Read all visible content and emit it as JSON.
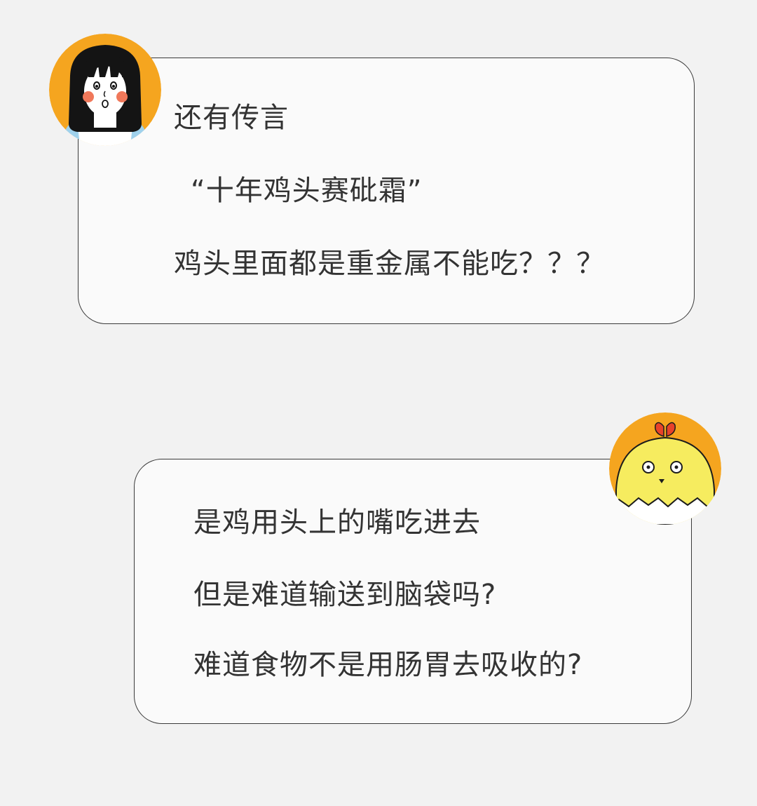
{
  "conversation": {
    "message_1": {
      "speaker": "girl-avatar",
      "lines": [
        "还有传言",
        "“十年鸡头赛砒霜”",
        "鸡头里面都是重金属不能吃？？？"
      ]
    },
    "message_2": {
      "speaker": "chick-avatar",
      "lines": [
        "是鸡用头上的嘴吃进去",
        "但是难道输送到脑袋吗?",
        "难道食物不是用肠胃去吸收的?"
      ]
    }
  },
  "colors": {
    "background": "#f2f2f2",
    "bubble_fill": "#fafafa",
    "bubble_border": "#3a3a3a",
    "text": "#333333",
    "avatar_orange": "#f5a51f",
    "chick_yellow": "#f6ec5f",
    "comb_red": "#e8422a",
    "cheek_pink": "#f0785a"
  },
  "icons": [
    "girl-avatar-icon",
    "chick-avatar-icon"
  ]
}
